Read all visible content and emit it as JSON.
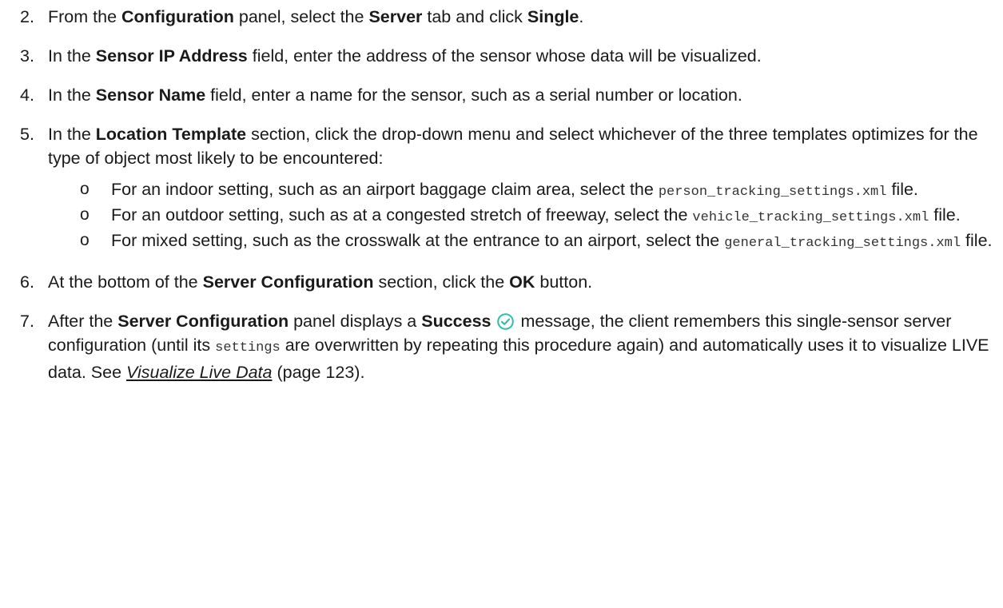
{
  "steps": [
    {
      "num": "2.",
      "t1": "From the ",
      "b1": "Configuration",
      "t2": " panel, select the ",
      "b2": "Server",
      "t3": " tab and click ",
      "b3": "Single",
      "t4": "."
    },
    {
      "num": "3.",
      "t1": "In the ",
      "b1": "Sensor IP Address",
      "t2": " field, enter the address of the sensor whose data will be visualized."
    },
    {
      "num": "4.",
      "t1": "In the ",
      "b1": "Sensor Name",
      "t2": " field, enter a name for the sensor, such as a serial number or location."
    },
    {
      "num": "5.",
      "t1": "In the ",
      "b1": "Location Template",
      "t2": " section, click the drop-down menu and select whichever of the three templates optimizes for the type of object most likely to be encountered:",
      "bullets": [
        {
          "marker": "o",
          "text": "For an indoor setting, such as an airport baggage claim area, select the ",
          "code": "person_tracking_settings.xml",
          "suffix": " file."
        },
        {
          "marker": "o",
          "text": "For an outdoor setting, such as at a congested stretch of freeway, select the ",
          "code": "vehicle_tracking_settings.xml",
          "suffix": " file."
        },
        {
          "marker": "o",
          "text": "For mixed setting, such as the crosswalk at the entrance to an airport, select the ",
          "code": "general_tracking_settings.xml",
          "suffix": " file."
        }
      ]
    },
    {
      "num": "6.",
      "t1": "At the bottom of the ",
      "b1": "Server Configuration",
      "t2": " section, click the ",
      "b2": "OK",
      "t3": " button."
    },
    {
      "num": "7.",
      "t1": "After the ",
      "b1": "Server Configuration",
      "t2": " panel displays a ",
      "b2": "Success",
      "t3": " message, the client remembers this single-sensor server configuration (until its ",
      "code": "settings",
      "t4": " are overwritten by repeating this procedure again) and automatically uses it to visualize LIVE data. See ",
      "link": "Visualize Live Data",
      "t5": " (page 123)."
    }
  ],
  "colors": {
    "text": "#1a1a1a",
    "success_icon": "#2bbfa4"
  }
}
